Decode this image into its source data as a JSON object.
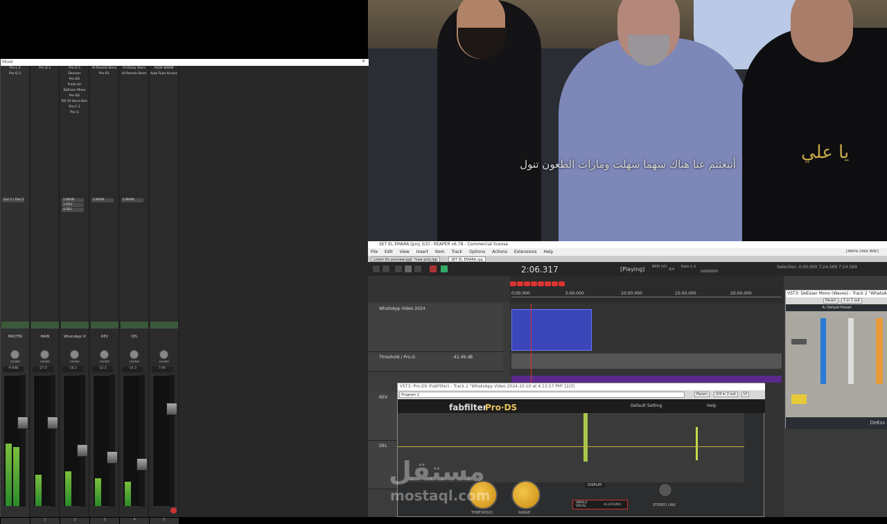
{
  "video": {
    "subtitle": "أتبعثتم عنا هناك سهما سهلت ومارات الطعون تنول",
    "calligraphy": "يا علي"
  },
  "mixer": {
    "title": "Mixer",
    "strips": [
      {
        "name": "MASTER",
        "fx": [
          "Pro-L 2",
          "Pro-Q 3"
        ],
        "sends": [
          "Out 1 / Out 2"
        ],
        "pan": "center",
        "vol": "-9.6dB",
        "num": ""
      },
      {
        "name": "MAIN",
        "fx": [
          "Pro-Q 3"
        ],
        "sends": [],
        "pan": "center",
        "vol": "-27.0",
        "num": "1"
      },
      {
        "name": "WhatsApp Vi",
        "fx": [
          "Pro-Q 3",
          "Deesser",
          "Pro-DS",
          "Fresh Air",
          "DeEsser Mono",
          "Pro-DS",
          "RX 10 Voice Den",
          "Pro-C 2",
          "Pro-G"
        ],
        "sends": [
          "1:MAIN",
          "1:REV",
          "4:DEL"
        ],
        "pan": "center",
        "vol": "-18.2",
        "num": "2"
      },
      {
        "name": "REV",
        "fx": [
          "Hi-Reverb Stere",
          "Pro-D1"
        ],
        "sends": [
          "1:MAIN"
        ],
        "pan": "center",
        "vol": "-22.5",
        "num": "3"
      },
      {
        "name": "DEL",
        "fx": [
          "Hi-Delay Stere",
          "Hi-Reverb Stere"
        ],
        "sends": [
          "1:MAIN"
        ],
        "pan": "center",
        "vol": "-14.3",
        "num": "4"
      },
      {
        "name": "",
        "fx": [
          "AVOX WARM",
          "Auto-Tune Access"
        ],
        "sends": [],
        "pan": "center",
        "vol": "7.90",
        "num": "5"
      }
    ]
  },
  "reaper": {
    "title": "SET EL EMARA [proj 3/3] - REAPER v6.78 - Commercial license",
    "menu": [
      "File",
      "Edit",
      "View",
      "Insert",
      "Item",
      "Track",
      "Options",
      "Actions",
      "Extensions",
      "Help"
    ],
    "tabs": [
      "Listen for preview.rpp",
      "*new proj.rpp",
      "SET EL EMARA.rpp"
    ],
    "time": "2:06.317",
    "state": "[Playing]",
    "bpm": "BPM 141",
    "sig": "4/4",
    "rate": "Rate 1.0",
    "selection": "Selection: 0:00.000 7:24.569 7:24.569",
    "format": "[48kHz 24bit WAV]",
    "ruler": [
      "0:00.000",
      "5:00.000",
      "10:00.000",
      "15:00.000",
      "20:00.000"
    ],
    "tracks": [
      {
        "name": "WhatsApp Video 2024"
      },
      {
        "name": "Threshold / Pro-G",
        "value": "-41.49 dB"
      },
      {
        "name": "REV"
      },
      {
        "name": "DEL"
      }
    ]
  },
  "deesser": {
    "title": "VST3: DeEsser Mono (Waves) - Track 2 \"WhatsAp...",
    "preset": "A: Default Preset",
    "io": "1 in 1 out",
    "param": "Param",
    "footer": "DeEss"
  },
  "prods": {
    "title": "VST3: Pro-DS (FabFilter) - Track 2 \"WhatsApp Video 2024-10-10 at 4.13.57 PM\" [2/3]",
    "program": "Program 1",
    "param": "Param",
    "io": "2/4 in 2 out",
    "ui": "UI",
    "brand": "fabfilter",
    "product": "Pro·DS",
    "preset": "Default Setting",
    "help": "Help",
    "display": "DISPLAY",
    "threshold": "THRESHOLD",
    "range": "RANGE",
    "mode_single": "SINGLE VOCAL",
    "mode_all": "ALLROUND",
    "stereo": "STEREO LINK"
  },
  "watermark": {
    "ar": "مستقل",
    "en": "mostaql.com"
  }
}
